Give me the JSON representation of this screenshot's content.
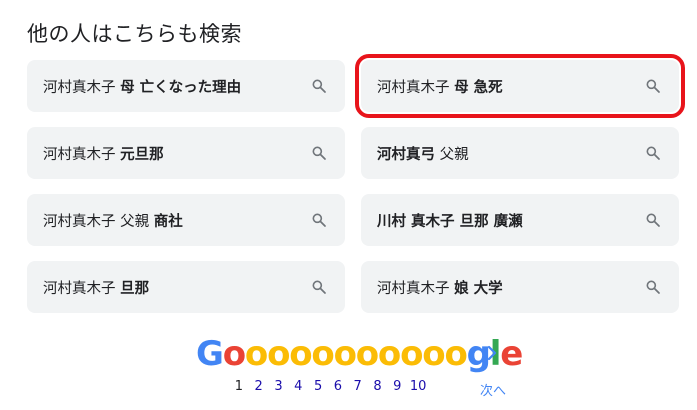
{
  "section": {
    "heading": "他の人はこちらも検索"
  },
  "suggestions": [
    {
      "plain": "河村真木子 ",
      "bold": "母 亡くなった理由",
      "plain2": "",
      "highlighted": false
    },
    {
      "plain": "河村真木子 ",
      "bold": "母 急死",
      "plain2": "",
      "highlighted": true
    },
    {
      "plain": "河村真木子 ",
      "bold": "元旦那",
      "plain2": "",
      "highlighted": false
    },
    {
      "plain": "",
      "bold": "河村真弓",
      "plain2": " 父親",
      "highlighted": false
    },
    {
      "plain": "河村真木子 父親 ",
      "bold": "商社",
      "plain2": "",
      "highlighted": false
    },
    {
      "plain": "",
      "bold": "川村 真木子 旦那 廣瀬",
      "plain2": "",
      "highlighted": false
    },
    {
      "plain": "河村真木子 ",
      "bold": "旦那",
      "plain2": "",
      "highlighted": false
    },
    {
      "plain": "河村真木子 ",
      "bold": "娘 大学",
      "plain2": "",
      "highlighted": false
    }
  ],
  "pagination": {
    "logo_letters": [
      "G",
      "o",
      "o",
      "o",
      "o",
      "o",
      "o",
      "o",
      "o",
      "o",
      "o",
      "o",
      "g",
      "l",
      "e"
    ],
    "pages": [
      "1",
      "2",
      "3",
      "4",
      "5",
      "6",
      "7",
      "8",
      "9",
      "10"
    ],
    "current_page": "1",
    "next_label": "次へ"
  },
  "colors": {
    "highlight": "#e8141b",
    "chip_bg": "#f1f3f4",
    "link": "#1a0dab"
  }
}
